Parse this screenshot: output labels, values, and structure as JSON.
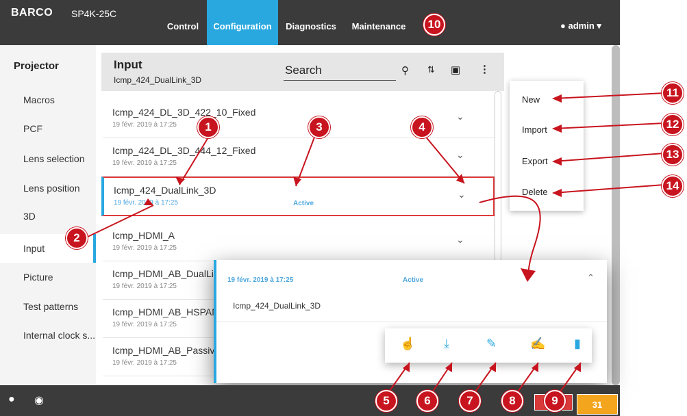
{
  "header": {
    "brand": "BARCO",
    "model": "SP4K-25C",
    "nav": [
      "Control",
      "Configuration",
      "Diagnostics",
      "Maintenance"
    ],
    "active_nav": "Configuration",
    "user": "admin"
  },
  "sidebar": {
    "title": "Projector",
    "items": [
      "Macros",
      "PCF",
      "Lens selection",
      "Lens position",
      "3D",
      "Input",
      "Picture",
      "Test patterns",
      "Internal clock s..."
    ],
    "selected": "Input"
  },
  "panel": {
    "title": "Input",
    "subtitle": "Icmp_424_DualLink_3D",
    "search_placeholder": "Search"
  },
  "rows": [
    {
      "name": "Icmp_424_DL_3D_422_10_Fixed",
      "date": "19 févr. 2019 à 17:25",
      "status": ""
    },
    {
      "name": "Icmp_424_DL_3D_444_12_Fixed",
      "date": "19 févr. 2019 à 17:25",
      "status": ""
    },
    {
      "name": "Icmp_424_DualLink_3D",
      "date": "19 févr. 2019 à 17:25",
      "status": "Active"
    },
    {
      "name": "Icmp_HDMI_A",
      "date": "19 févr. 2019 à 17:25",
      "status": ""
    },
    {
      "name": "Icmp_HDMI_AB_DualLi",
      "date": "19 févr. 2019 à 17:25",
      "status": ""
    },
    {
      "name": "Icmp_HDMI_AB_HSPAN",
      "date": "19 févr. 2019 à 17:25",
      "status": ""
    },
    {
      "name": "Icmp_HDMI_AB_Passiv",
      "date": "19 févr. 2019 à 17:25",
      "status": ""
    }
  ],
  "menu": {
    "items": [
      "New",
      "Import",
      "Export",
      "Delete"
    ]
  },
  "card": {
    "date": "19 févr. 2019 à 17:25",
    "status": "Active",
    "name": "Icmp_424_DualLink_3D"
  },
  "actions": [
    "activate-icon",
    "download-icon",
    "edit-icon",
    "rename-icon",
    "delete-icon"
  ],
  "bottom": {
    "badge": "31"
  },
  "callouts": [
    "1",
    "2",
    "3",
    "4",
    "5",
    "6",
    "7",
    "8",
    "9",
    "10",
    "11",
    "12",
    "13",
    "14"
  ],
  "colors": {
    "accent": "#29a8e0",
    "callout": "#c8141e",
    "header": "#3b3b3b",
    "warning": "#f4a51e",
    "error": "#d83a3a"
  }
}
